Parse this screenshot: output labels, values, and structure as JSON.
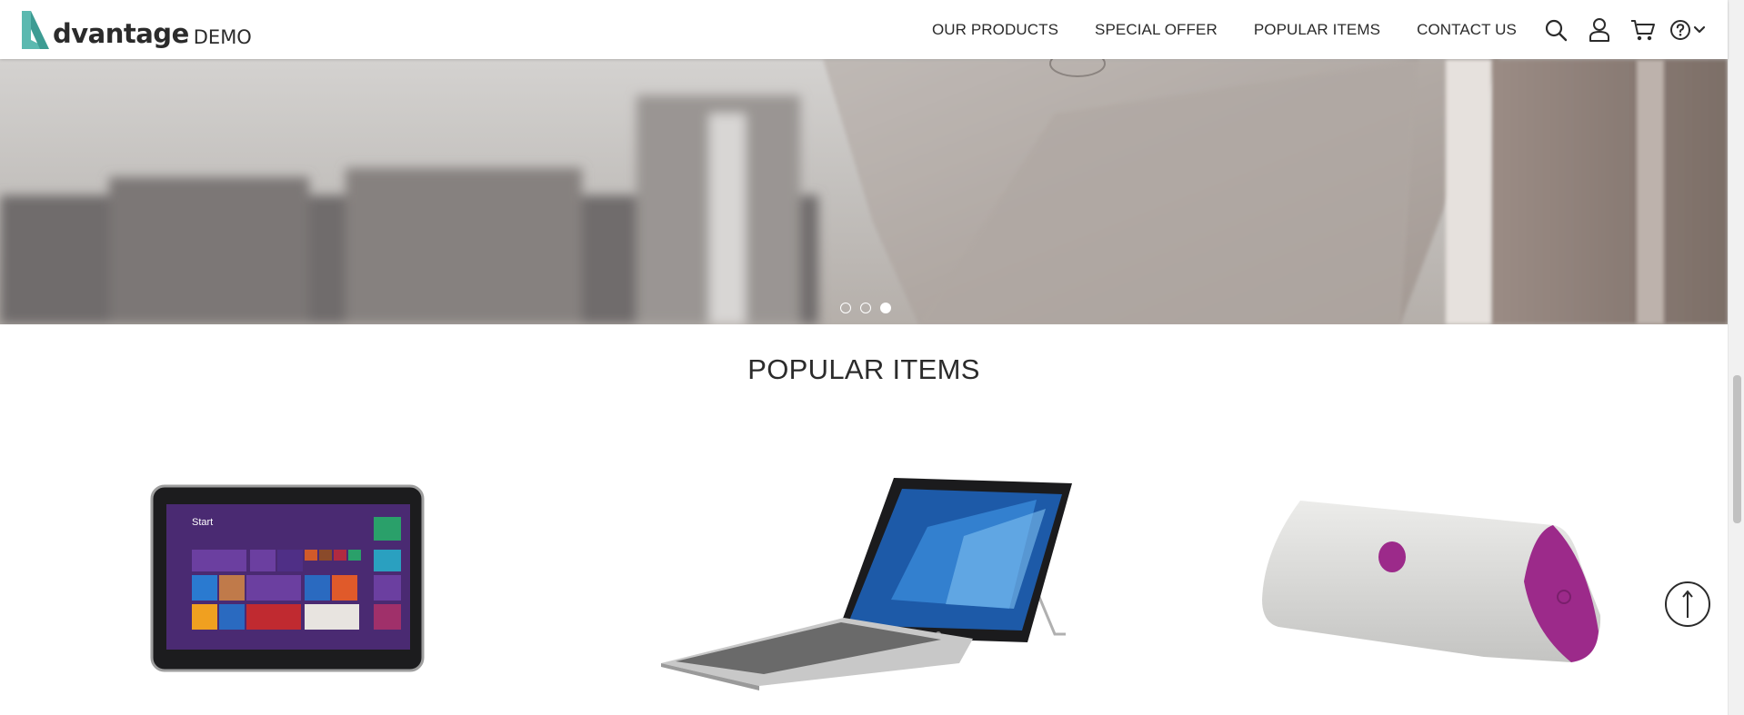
{
  "header": {
    "logo": {
      "brand": "dvantage",
      "suffix": "DEMO",
      "accent_color": "#5bb9b0"
    },
    "nav": [
      {
        "label": "OUR PRODUCTS"
      },
      {
        "label": "SPECIAL OFFER"
      },
      {
        "label": "POPULAR ITEMS"
      },
      {
        "label": "CONTACT US"
      }
    ],
    "icons": [
      "search-icon",
      "user-icon",
      "cart-icon",
      "help-icon",
      "chevron-down-icon"
    ]
  },
  "hero": {
    "slides_total": 3,
    "active_slide": 3
  },
  "popular": {
    "title": "POPULAR ITEMS",
    "items": [
      {
        "icon": "tablet-product-image"
      },
      {
        "icon": "laptop-product-image"
      },
      {
        "icon": "speaker-product-image",
        "accent_color": "#9c2a8a"
      }
    ]
  },
  "colors": {
    "text": "#2b2b2b",
    "accent_teal": "#5bb9b0",
    "speaker_purple": "#9c2a8a"
  }
}
